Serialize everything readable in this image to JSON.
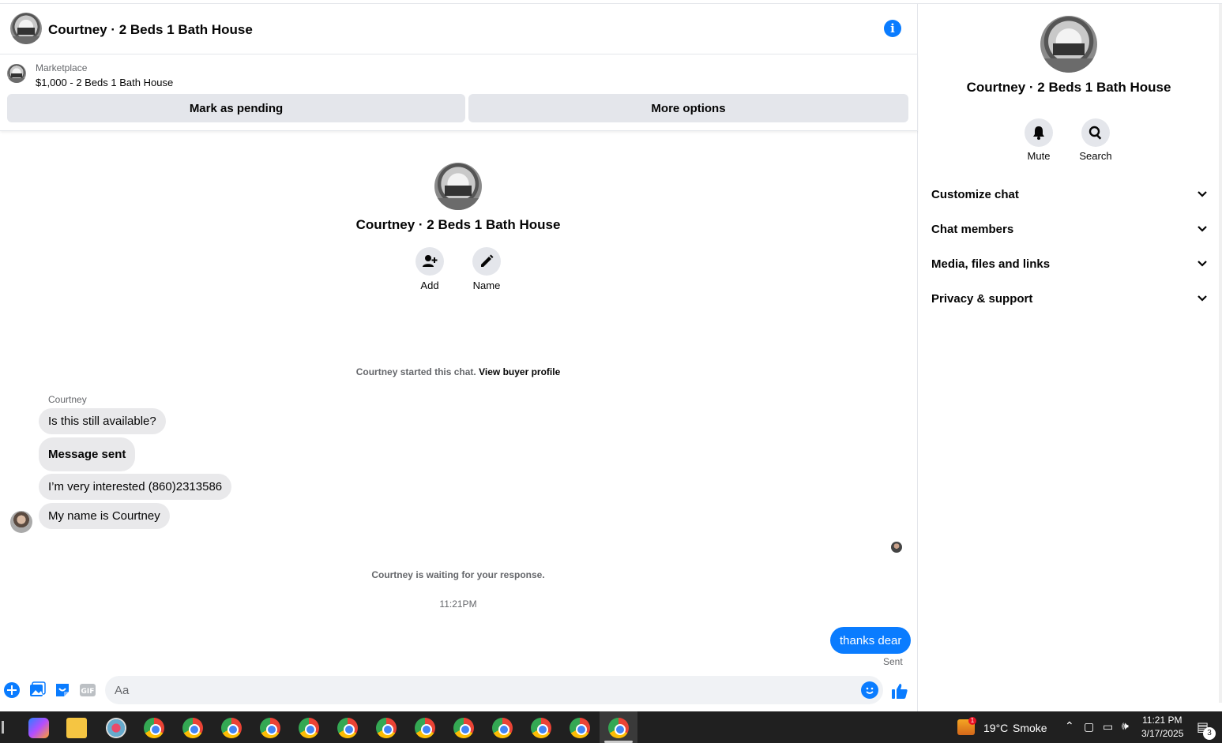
{
  "header": {
    "title": "Courtney · 2 Beds 1 Bath House"
  },
  "marketplace": {
    "label": "Marketplace",
    "item": "$1,000 - 2 Beds 1 Bath House",
    "pending_button": "Mark as pending",
    "more_button": "More options"
  },
  "intro": {
    "title": "Courtney · 2 Beds 1 Bath House",
    "add_label": "Add",
    "name_label": "Name"
  },
  "conversation": {
    "started_text": "Courtney started this chat.",
    "buyer_link": "View buyer profile",
    "sender": "Courtney",
    "messages": [
      "Is this still available?",
      "Message sent",
      "I’m very interested (860)2313586",
      "My name is Courtney"
    ],
    "waiting_text": "Courtney is waiting for your response.",
    "timestamp": "11:21PM",
    "outgoing": "thanks dear",
    "sent_status": "Sent"
  },
  "composer": {
    "placeholder": "Aa"
  },
  "sidebar": {
    "title": "Courtney · 2 Beds 1 Bath House",
    "mute_label": "Mute",
    "search_label": "Search",
    "sections": [
      "Customize chat",
      "Chat members",
      "Media, files and links",
      "Privacy & support"
    ]
  },
  "taskbar": {
    "weather_temp": "19°C",
    "weather_desc": "Smoke",
    "weather_badge": "1",
    "time": "11:21 PM",
    "date": "3/17/2025",
    "notification_count": "3"
  },
  "colors": {
    "accent": "#0a7cff",
    "bubble_in": "#e9e9eb",
    "button_bg": "#e4e6eb",
    "taskbar": "#202020"
  }
}
